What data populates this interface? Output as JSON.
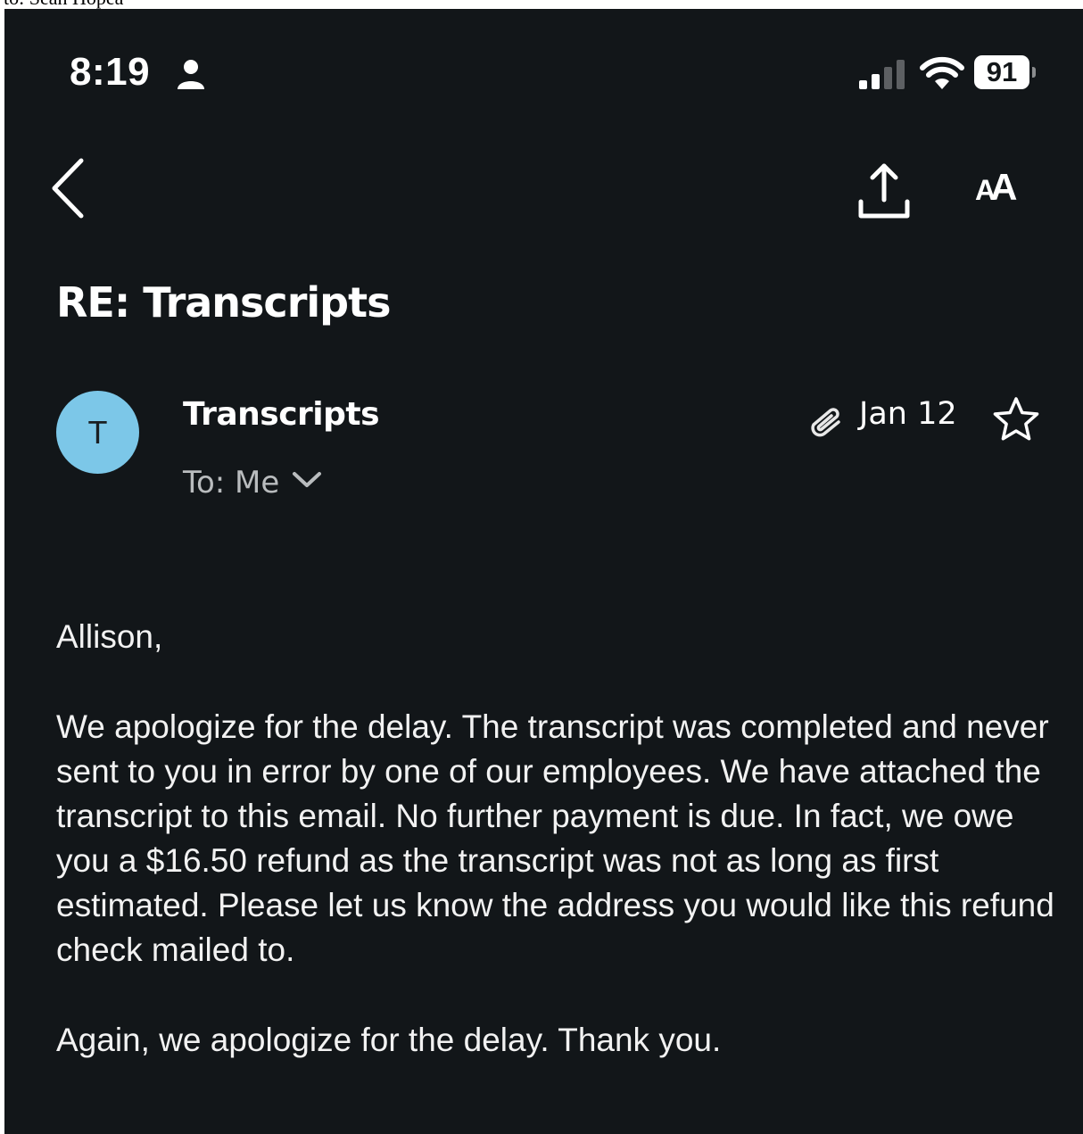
{
  "top_strip": {
    "text": "to: Sean Hopea"
  },
  "status_bar": {
    "time": "8:19",
    "battery": "91",
    "icons": [
      "person-icon",
      "cellular-signal-icon",
      "wifi-icon",
      "battery-icon"
    ]
  },
  "nav": {
    "back_icon": "chevron-left-icon",
    "share_icon": "share-icon",
    "text_size_label_small": "A",
    "text_size_label_large": "A"
  },
  "email": {
    "subject": "RE: Transcripts",
    "avatar_letter": "T",
    "avatar_color": "#7cc7e8",
    "sender": "Transcripts",
    "recipient_label": "To: Me",
    "date": "Jan 12",
    "has_attachment": true,
    "starred": false,
    "body": {
      "greeting": "Allison,",
      "paragraph": "We apologize for the delay. The transcript was completed and never sent to you in error by one of our employees. We have attached the transcript to this email. No further payment is due. In fact, we owe you a $16.50 refund as the transcript was not as long as first estimated.  Please let us know the address you would like this refund check mailed to.",
      "closing": "Again, we apologize for the delay. Thank you."
    }
  },
  "colors": {
    "background": "#121619",
    "text": "#ffffff",
    "secondary_text": "#b9bcbe"
  }
}
